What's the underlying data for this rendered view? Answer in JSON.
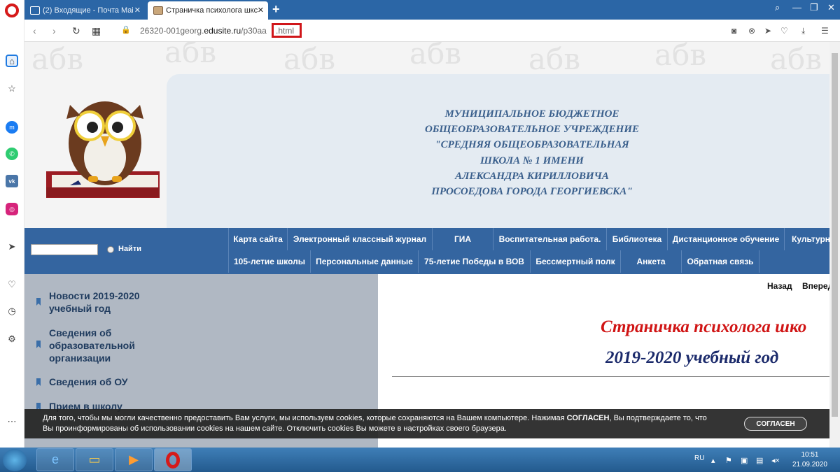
{
  "browser": {
    "tabs": [
      {
        "label": "(2) Входящие - Почта Mai",
        "icon": "mail-icon"
      },
      {
        "label": "Страничка психолога шкс",
        "icon": "owl-favicon"
      }
    ],
    "url_prefix": "26320-001georg.",
    "url_domain": "edusite.ru",
    "url_path": "/p30aa",
    "url_ext": ".html"
  },
  "school": {
    "lines": [
      "МУНИЦИПАЛЬНОЕ БЮДЖЕТНОЕ",
      "ОБЩЕОБРАЗОВАТЕЛЬНОЕ УЧРЕЖДЕНИЕ",
      "\"СРЕДНЯЯ ОБЩЕОБРАЗОВАТЕЛЬНАЯ",
      "ШКОЛА № 1 ИМЕНИ",
      "АЛЕКСАНДРА КИРИЛЛОВИЧА",
      "ПРОСОЕДОВА ГОРОДА ГЕОРГИЕВСКА\""
    ]
  },
  "search": {
    "button": "Найти"
  },
  "menu": {
    "row1": [
      "Карта сайта",
      "Электронный классный журнал",
      "ГИА",
      "Воспитательная работа.",
      "Библиотека",
      "Дистанционное обучение",
      "Культурн"
    ],
    "row2": [
      "105-летие школы",
      "Персональные данные",
      "75-летие Победы в ВОВ",
      "Бессмертный полк",
      "Анкета",
      "Обратная связь"
    ]
  },
  "sidebar": {
    "items": [
      {
        "label": "Новости 2019-2020 учебный год"
      },
      {
        "label": "Сведения об образовательной организации"
      },
      {
        "label": "Сведения об ОУ"
      },
      {
        "label": "Прием в школу"
      }
    ]
  },
  "content": {
    "back": "Назад",
    "forward": "Вперед",
    "title": "Страничка психолога шко",
    "year": "2019-2020 учебный год"
  },
  "cookie": {
    "text1": "Для того, чтобы мы могли качественно предоставить Вам услуги, мы используем cookies, которые сохраняются на Вашем компьютере. Нажимая ",
    "text_bold": "СОГЛАСЕН",
    "text2": ", Вы подтверждаете то, что",
    "line2": "Вы проинформированы об использовании cookies на нашем сайте. Отключить cookies Вы можете в настройках своего браузера.",
    "button": "СОГЛАСЕН"
  },
  "taskbar": {
    "lang": "RU",
    "time": "10:51",
    "date": "21.09.2020"
  },
  "colors": {
    "menu": "#3465a0",
    "accent_red": "#d01414",
    "title_blue": "#1b2a6b",
    "tabbar": "#2b66a6"
  }
}
